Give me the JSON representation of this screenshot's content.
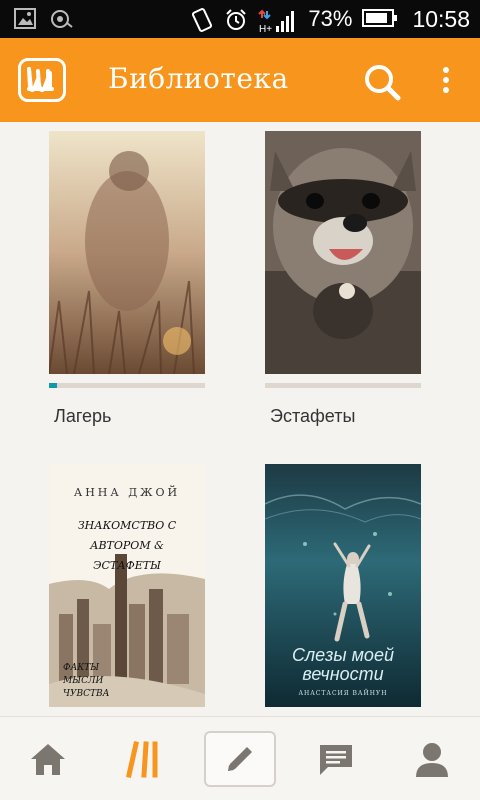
{
  "status_bar": {
    "battery": "73%",
    "time": "10:58",
    "network": "H+"
  },
  "app_bar": {
    "title": "Библиотека",
    "accent_color": "#f7951d"
  },
  "books": [
    {
      "title": "Лагерь",
      "progress": 0.05
    },
    {
      "title": "Эстафеты",
      "progress": 0
    },
    {
      "title": "",
      "cover_text": {
        "author": "АННА ДЖОЙ",
        "heading": "ЗНАКОМСТВО С АВТОРОМ & ЭСТАФЕТЫ",
        "footer": "ФАКТЫ МЫСЛИ ЧУВСТВА"
      }
    },
    {
      "title": "",
      "cover_text": {
        "title": "Слезы моей вечности",
        "author": "АНАСТАСИЯ ВАЙНУН"
      }
    }
  ],
  "bottom_nav": {
    "items": [
      "home-icon",
      "library-icon",
      "write-icon",
      "messages-icon",
      "profile-icon"
    ],
    "active": "library-icon"
  }
}
